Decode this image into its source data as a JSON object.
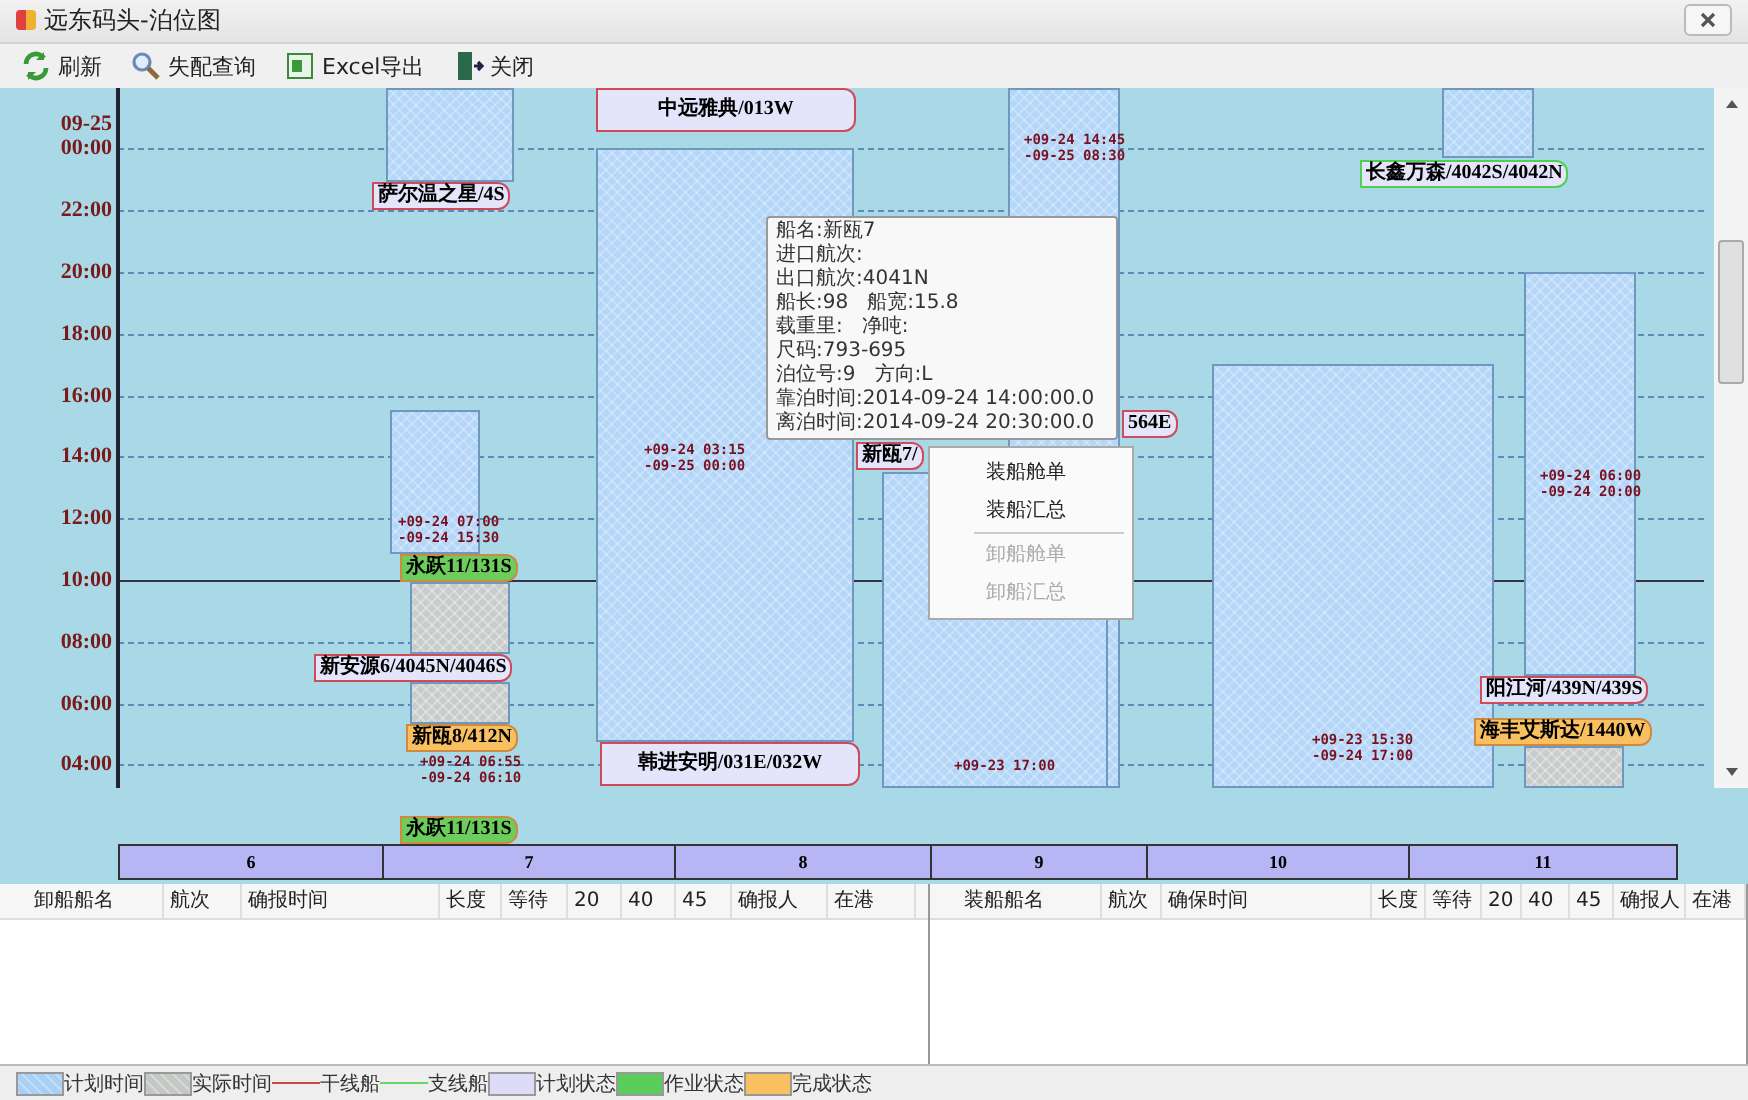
{
  "window": {
    "title": "远东码头-泊位图"
  },
  "toolbar": [
    {
      "label": "刷新"
    },
    {
      "label": "失配查询"
    },
    {
      "label": "Excel导出"
    },
    {
      "label": "关闭"
    }
  ],
  "chart": {
    "y_axis": [
      [
        "09-25",
        "00:00"
      ],
      [
        "22:00"
      ],
      [
        "20:00"
      ],
      [
        "18:00"
      ],
      [
        "16:00"
      ],
      [
        "14:00"
      ],
      [
        "12:00"
      ],
      [
        "10:00"
      ],
      [
        "08:00"
      ],
      [
        "06:00"
      ],
      [
        "04:00"
      ]
    ],
    "blocks": [
      {
        "kind": "plan"
      },
      {
        "kind": "plan",
        "times": [
          "+09-24 03:15",
          "-09-25 00:00"
        ]
      },
      {
        "kind": "plan",
        "times": [
          "+09-24 14:45",
          "-09-25 08:30"
        ]
      },
      {
        "kind": "plan",
        "times": [
          "+09-23 17:00"
        ]
      },
      {
        "kind": "plan",
        "times": [
          "+09-23 15:30",
          "-09-24 17:00"
        ]
      },
      {
        "kind": "plan"
      },
      {
        "kind": "plan",
        "times": [
          "+09-24 06:00",
          "-09-24 20:00"
        ]
      },
      {
        "kind": "plan",
        "times": [
          "+09-24 07:00",
          "-09-24 15:30"
        ]
      },
      {
        "kind": "actual",
        "times": [
          "+09-24 06:55",
          "-09-24 06:10"
        ]
      },
      {
        "kind": "actual"
      }
    ],
    "tags": [
      {
        "text": "中远雅典/013W",
        "kind": "plan",
        "color": "#d04a5a"
      },
      {
        "text": "萨尔温之星/4S",
        "kind": "plan",
        "color": "#d04a5a"
      },
      {
        "text": "长鑫万森/4042S/4042N",
        "kind": "plan",
        "color": "#50d050"
      },
      {
        "text": "新瓯7/",
        "kind": "plan",
        "color": "#d04a5a"
      },
      {
        "text": "564E",
        "kind": "plan",
        "color": "#d04a5a"
      },
      {
        "text": "永跃11/131S",
        "kind": "work"
      },
      {
        "text": "新安源6/4045N/4046S",
        "kind": "plan",
        "color": "#d04a5a"
      },
      {
        "text": "新瓯8/412N",
        "kind": "done"
      },
      {
        "text": "韩进安明/031E/032W",
        "kind": "plan",
        "color": "#d04a5a"
      },
      {
        "text": "阳江河/439N/439S",
        "kind": "plan",
        "color": "#d04a5a"
      },
      {
        "text": "海丰艾斯达/1440W",
        "kind": "done"
      }
    ],
    "tooltip": [
      "船名:新瓯7",
      "进口航次:",
      "出口航次:4041N",
      "船长:98   船宽:15.8",
      "载重里:   净吨:",
      "尺码:793-695",
      "泊位号:9   方向:L",
      "靠泊时间:2014-09-24 14:00:00.0",
      "离泊时间:2014-09-24 20:30:00.0"
    ],
    "context_menu": [
      {
        "label": "装船舱单",
        "disabled": false
      },
      {
        "label": "装船汇总",
        "disabled": false
      },
      {
        "label": "卸船舱单",
        "disabled": true
      },
      {
        "label": "卸船汇总",
        "disabled": true
      }
    ]
  },
  "strip_tag": {
    "text": "永跃11/131S",
    "kind": "work"
  },
  "berths": [
    "6",
    "7",
    "8",
    "9",
    "10",
    "11"
  ],
  "unload_table": {
    "columns": [
      "卸船船名",
      "航次",
      "确报时间",
      "长度",
      "等待",
      "20",
      "40",
      "45",
      "确报人",
      "在港"
    ]
  },
  "load_table": {
    "columns": [
      "装船船名",
      "航次",
      "确保时间",
      "长度",
      "等待",
      "20",
      "40",
      "45",
      "确报人",
      "在港"
    ]
  },
  "legend": [
    {
      "label": "计划时间",
      "kind": "hatch",
      "color": "#a8cff5"
    },
    {
      "label": "实际时间",
      "kind": "hatch",
      "color": "#c4c8c4"
    },
    {
      "label": "干线船",
      "kind": "line",
      "color": "#c84848"
    },
    {
      "label": "支线船",
      "kind": "line",
      "color": "#66d866"
    },
    {
      "label": "计划状态",
      "kind": "swatch",
      "color": "#dcdcf8"
    },
    {
      "label": "作业状态",
      "kind": "swatch",
      "color": "#5ccc5c"
    },
    {
      "label": "完成状态",
      "kind": "swatch",
      "color": "#f8c060"
    }
  ]
}
